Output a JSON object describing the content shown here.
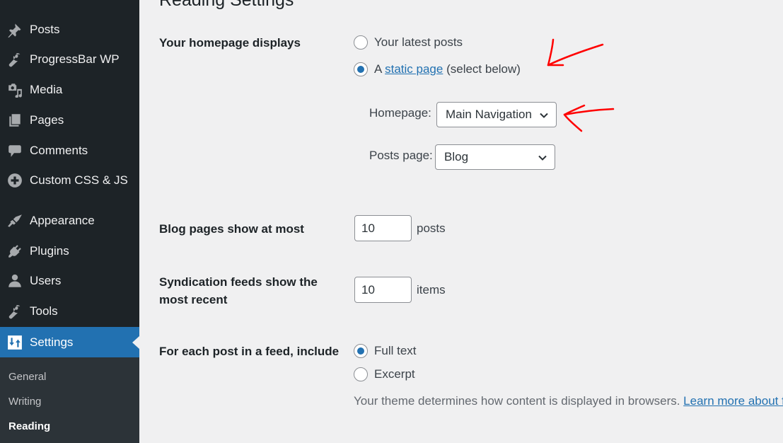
{
  "sidebar": {
    "items": [
      {
        "label": "Posts",
        "icon": "pin-icon"
      },
      {
        "label": "ProgressBar WP",
        "icon": "wrench-icon"
      },
      {
        "label": "Media",
        "icon": "media-icon"
      },
      {
        "label": "Pages",
        "icon": "pages-icon"
      },
      {
        "label": "Comments",
        "icon": "comment-icon"
      },
      {
        "label": "Custom CSS & JS",
        "icon": "plus-circle-icon"
      },
      {
        "label": "Appearance",
        "icon": "paintbrush-icon"
      },
      {
        "label": "Plugins",
        "icon": "plug-icon"
      },
      {
        "label": "Users",
        "icon": "user-icon"
      },
      {
        "label": "Tools",
        "icon": "wrench-icon"
      },
      {
        "label": "Settings",
        "icon": "settings-sliders-icon",
        "active": true
      }
    ],
    "submenu": [
      {
        "label": "General"
      },
      {
        "label": "Writing"
      },
      {
        "label": "Reading",
        "current": true
      }
    ]
  },
  "main": {
    "title": "Reading Settings",
    "homepage_displays": {
      "label": "Your homepage displays",
      "options": [
        {
          "label": "Your latest posts",
          "checked": false
        },
        {
          "prefix": "A ",
          "link": "static page",
          "suffix": " (select below)",
          "checked": true
        }
      ],
      "homepage_select": {
        "label": "Homepage:",
        "value": "Main Navigation"
      },
      "posts_page_select": {
        "label": "Posts page:",
        "value": "Blog"
      }
    },
    "blog_pages": {
      "label": "Blog pages show at most",
      "value": "10",
      "unit": "posts"
    },
    "syndication": {
      "label_line1": "Syndication feeds show the",
      "label_line2": "most recent",
      "value": "10",
      "unit": "items"
    },
    "feed_include": {
      "label": "For each post in a feed, include",
      "options": [
        {
          "label": "Full text",
          "checked": true
        },
        {
          "label": "Excerpt",
          "checked": false
        }
      ],
      "description": "Your theme determines how content is displayed in browsers. ",
      "learn_more": "Learn more about feeds"
    }
  },
  "colors": {
    "accent": "#2271b1",
    "sidebar_bg": "#1d2327",
    "submenu_bg": "#2c3338",
    "annotation": "#ff0000"
  }
}
